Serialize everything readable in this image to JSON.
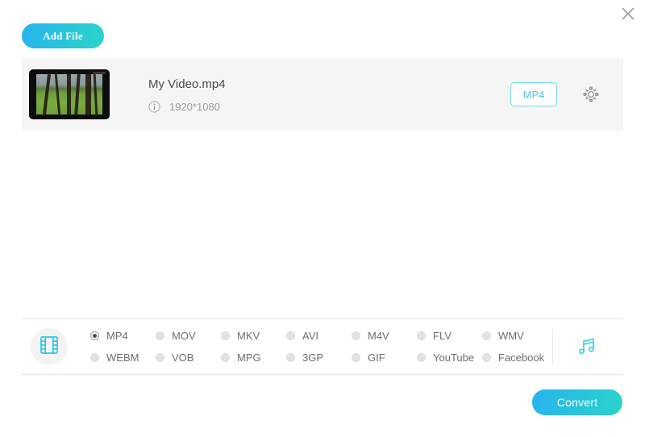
{
  "window": {
    "close_label": "×",
    "close_icon": "close-icon"
  },
  "toolbar": {
    "add_file_label": "Add File"
  },
  "file_row": {
    "name": "My Video.mp4",
    "resolution": "1920*1080",
    "info_icon": "info-circle-icon",
    "output_format_badge": "MP4",
    "settings_icon": "gear-icon",
    "thumbnail_icon": "video-thumbnail"
  },
  "format_panel": {
    "video_tab_icon": "film-strip-icon",
    "audio_tab_icon": "music-note-icon",
    "selected": "MP4",
    "options": [
      {
        "label": "MP4",
        "selected": true
      },
      {
        "label": "MOV",
        "selected": false
      },
      {
        "label": "MKV",
        "selected": false
      },
      {
        "label": "AVI",
        "selected": false
      },
      {
        "label": "M4V",
        "selected": false
      },
      {
        "label": "FLV",
        "selected": false
      },
      {
        "label": "WMV",
        "selected": false
      },
      {
        "label": "WEBM",
        "selected": false
      },
      {
        "label": "VOB",
        "selected": false
      },
      {
        "label": "MPG",
        "selected": false
      },
      {
        "label": "3GP",
        "selected": false
      },
      {
        "label": "GIF",
        "selected": false
      },
      {
        "label": "YouTube",
        "selected": false
      },
      {
        "label": "Facebook",
        "selected": false
      }
    ]
  },
  "actions": {
    "convert_label": "Convert"
  },
  "colors": {
    "accent_start": "#27b4ef",
    "accent_end": "#2ad3c9",
    "badge_border": "#6fd7e8",
    "badge_text": "#4ec6e0",
    "row_bg": "#f5f5f5"
  }
}
